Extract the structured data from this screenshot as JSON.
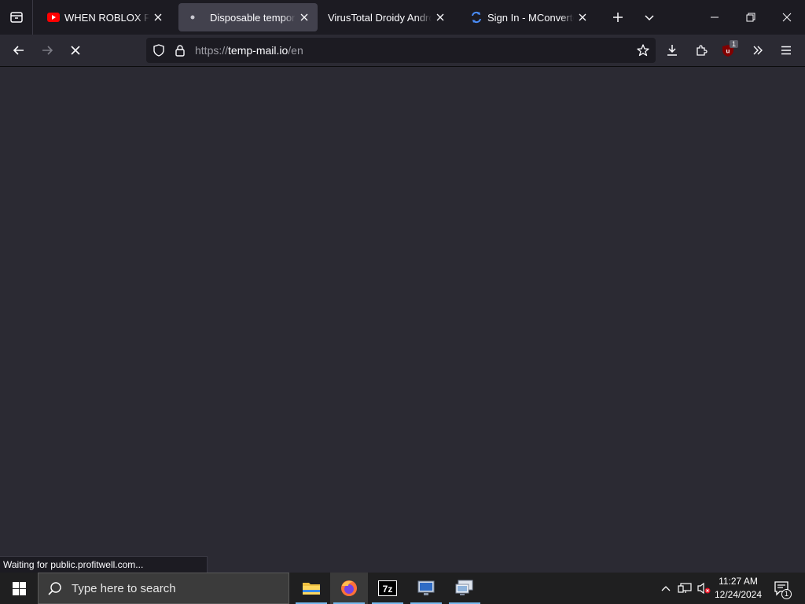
{
  "browser": {
    "tabs": [
      {
        "label": "WHEN ROBLOX FANS WATCH",
        "icon": "youtube-icon",
        "active": false
      },
      {
        "label": "Disposable temporary email",
        "icon": "loading-dot-icon",
        "active": true
      },
      {
        "label": "VirusTotal Droidy Android Sandbox",
        "icon": "",
        "active": false
      },
      {
        "label": "Sign In - MConverter App",
        "icon": "mconverter-icon",
        "active": false
      }
    ],
    "url": {
      "scheme": "https://",
      "host": "temp-mail.io",
      "path": "/en"
    },
    "status_text": "Waiting for public.profitwell.com...",
    "extension_badge": "1"
  },
  "taskbar": {
    "search_placeholder": "Type here to search",
    "time": "11:27 AM",
    "date": "12/24/2024",
    "notification_count": "1"
  },
  "colors": {
    "tabbar_bg": "#1c1b22",
    "toolbar_bg": "#2b2a33",
    "content_bg": "#2b2a33",
    "taskbar_bg": "#1f1f20",
    "accent": "#76b9ed"
  }
}
